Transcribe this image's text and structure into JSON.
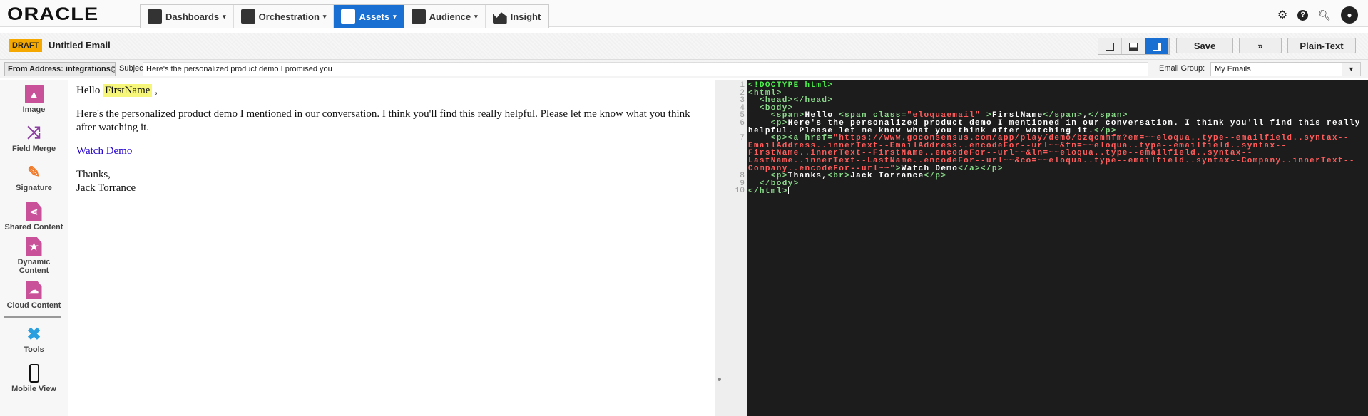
{
  "nav": {
    "logo": "ORACLE",
    "items": [
      {
        "label": "Dashboards",
        "caret": "▾"
      },
      {
        "label": "Orchestration",
        "caret": "▾"
      },
      {
        "label": "Assets",
        "caret": "▾"
      },
      {
        "label": "Audience",
        "caret": "▾"
      },
      {
        "label": "Insight"
      }
    ]
  },
  "header": {
    "badge": "DRAFT",
    "title": "Untitled Email",
    "save": "Save",
    "more": "»",
    "plain_text": "Plain-Text"
  },
  "address": {
    "from": "From Address: integrations@goconsen...",
    "subject_label": "Subject:",
    "subject": "Here's the personalized product demo I promised you",
    "group_label": "Email Group:",
    "group": "My Emails"
  },
  "sidebar": [
    "Image",
    "Field Merge",
    "Signature",
    "Shared Content",
    "Dynamic Content",
    "Cloud Content",
    "Tools",
    "Mobile View"
  ],
  "editor": {
    "hello": "Hello",
    "merge": "FirstName",
    "comma": ",",
    "body": "Here's the personalized product demo I mentioned in our conversation. I think you'll find this really helpful. Please let me know what you think after watching it.",
    "link": "Watch Demo",
    "thanks": "Thanks,",
    "name": "Jack Torrance"
  },
  "code": {
    "line_numbers": [
      "1",
      "2",
      "3",
      "4",
      "5",
      "6",
      "",
      "7",
      "",
      "",
      "",
      "",
      "8",
      "9",
      "10"
    ],
    "doctype": "<!DOCTYPE html>",
    "html_open": "<html>",
    "head": "  <head></head>",
    "body_open": "  <body>",
    "span_open": "    <span>",
    "hello": "Hello ",
    "span_class_open": "<span class=",
    "class_val": "\"eloquaemail\"",
    "gt": " >",
    "firstname": "FirstName",
    "span_close": "</span>",
    ",": ",",
    "span_close2": "</span>",
    "p_open": "    <p>",
    "para1": "Here's the personalized product demo I mentioned in our conversation. I think you'll find this really",
    "para2": "helpful. Please let me know what you think after watching it.",
    "p_close": "</p>",
    "a_open": "    <p><a href=",
    "href1": "\"https://www.goconsensus.com/app/play/demo/bzqcmmfm?em=~~eloqua..type--emailfield..syntax--",
    "href2": "EmailAddress..innerText--EmailAddress..encodeFor--url~~&fn=~~eloqua..type--emailfield..syntax--",
    "href3": "FirstName..innerText--FirstName..encodeFor--url~~&ln=~~eloqua..type--emailfield..syntax--",
    "href4": "LastName..innerText--LastName..encodeFor--url~~&co=~~eloqua..type--emailfield..syntax--Company..innerText--",
    "href5": "Company..encodeFor--url~~\"",
    "a_gt": ">",
    "link": "Watch Demo",
    "a_close": "</a></p>",
    "thanks_open": "    <p>",
    "thanks": "Thanks,",
    "br": "<br>",
    "name": "Jack Torrance",
    "thanks_close": "</p>",
    "body_close": "  </body>",
    "html_close": "</html>"
  },
  "colors": {
    "accent": "#1a6fd2",
    "draft": "#f5a800",
    "code_bg": "#1c1c1c",
    "tag": "#8ad98a",
    "string": "#ff5c5c"
  }
}
